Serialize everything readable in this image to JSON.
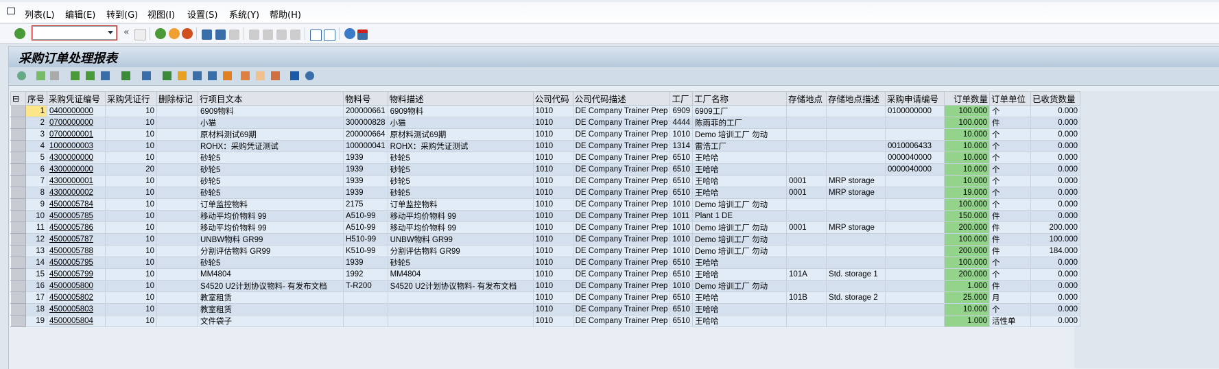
{
  "menu": [
    "列表(L)",
    "编辑(E)",
    "转到(G)",
    "视图(I)",
    "设置(S)",
    "系统(Y)",
    "帮助(H)"
  ],
  "command_field": {
    "value": ""
  },
  "title": "采购订单处理报表",
  "columns": [
    "序号",
    "采购凭证编号",
    "采购凭证行",
    "删除标记",
    "行项目文本",
    "物料号",
    "物料描述",
    "公司代码",
    "公司代码描述",
    "工厂",
    "工厂名称",
    "存储地点",
    "存储地点描述",
    "采购申请编号",
    "订单数量",
    "订单单位",
    "已收货数量"
  ],
  "rows": [
    [
      "1",
      "0400000000",
      "10",
      "",
      "6909物料",
      "200000661",
      "6909物料",
      "1010",
      "DE Company Trainer Prep",
      "6909",
      "6909工厂",
      "",
      "",
      "0100000000",
      "100.000",
      "个",
      "0.000"
    ],
    [
      "2",
      "0700000000",
      "10",
      "",
      "小猫",
      "300000828",
      "小猫",
      "1010",
      "DE Company Trainer Prep",
      "4444",
      "陈雨菲的工厂",
      "",
      "",
      "",
      "100.000",
      "件",
      "0.000"
    ],
    [
      "3",
      "0700000001",
      "10",
      "",
      "原材料测试69期",
      "200000664",
      "原材料测试69期",
      "1010",
      "DE Company Trainer Prep",
      "1010",
      "Demo 培训工厂 勿动",
      "",
      "",
      "",
      "10.000",
      "个",
      "0.000"
    ],
    [
      "4",
      "1000000003",
      "10",
      "",
      "ROHX：采购凭证测试",
      "100000041",
      "ROHX：采购凭证测试",
      "1010",
      "DE Company Trainer Prep",
      "1314",
      "雷浩工厂",
      "",
      "",
      "0010006433",
      "10.000",
      "个",
      "0.000"
    ],
    [
      "5",
      "4300000000",
      "10",
      "",
      "砂轮5",
      "1939",
      "砂轮5",
      "1010",
      "DE Company Trainer Prep",
      "6510",
      "王哈哈",
      "",
      "",
      "0000040000",
      "10.000",
      "个",
      "0.000"
    ],
    [
      "6",
      "4300000000",
      "20",
      "",
      "砂轮5",
      "1939",
      "砂轮5",
      "1010",
      "DE Company Trainer Prep",
      "6510",
      "王哈哈",
      "",
      "",
      "0000040000",
      "10.000",
      "个",
      "0.000"
    ],
    [
      "7",
      "4300000001",
      "10",
      "",
      "砂轮5",
      "1939",
      "砂轮5",
      "1010",
      "DE Company Trainer Prep",
      "6510",
      "王哈哈",
      "0001",
      "MRP storage",
      "",
      "10.000",
      "个",
      "0.000"
    ],
    [
      "8",
      "4300000002",
      "10",
      "",
      "砂轮5",
      "1939",
      "砂轮5",
      "1010",
      "DE Company Trainer Prep",
      "6510",
      "王哈哈",
      "0001",
      "MRP storage",
      "",
      "19.000",
      "个",
      "0.000"
    ],
    [
      "9",
      "4500005784",
      "10",
      "",
      "订单监控物料",
      "2175",
      "订单监控物料",
      "1010",
      "DE Company Trainer Prep",
      "1010",
      "Demo 培训工厂 勿动",
      "",
      "",
      "",
      "100.000",
      "个",
      "0.000"
    ],
    [
      "10",
      "4500005785",
      "10",
      "",
      "移动平均价物料 99",
      "A510-99",
      "移动平均价物料 99",
      "1010",
      "DE Company Trainer Prep",
      "1011",
      "Plant 1 DE",
      "",
      "",
      "",
      "150.000",
      "件",
      "0.000"
    ],
    [
      "11",
      "4500005786",
      "10",
      "",
      "移动平均价物料 99",
      "A510-99",
      "移动平均价物料 99",
      "1010",
      "DE Company Trainer Prep",
      "1010",
      "Demo 培训工厂 勿动",
      "0001",
      "MRP storage",
      "",
      "200.000",
      "件",
      "200.000"
    ],
    [
      "12",
      "4500005787",
      "10",
      "",
      "UNBW物料 GR99",
      "H510-99",
      "UNBW物料 GR99",
      "1010",
      "DE Company Trainer Prep",
      "1010",
      "Demo 培训工厂 勿动",
      "",
      "",
      "",
      "100.000",
      "件",
      "100.000"
    ],
    [
      "13",
      "4500005788",
      "10",
      "",
      "分割评估物料 GR99",
      "K510-99",
      "分割评估物料 GR99",
      "1010",
      "DE Company Trainer Prep",
      "1010",
      "Demo 培训工厂 勿动",
      "",
      "",
      "",
      "200.000",
      "件",
      "184.000"
    ],
    [
      "14",
      "4500005795",
      "10",
      "",
      "砂轮5",
      "1939",
      "砂轮5",
      "1010",
      "DE Company Trainer Prep",
      "6510",
      "王哈哈",
      "",
      "",
      "",
      "100.000",
      "个",
      "0.000"
    ],
    [
      "15",
      "4500005799",
      "10",
      "",
      "MM4804",
      "1992",
      "MM4804",
      "1010",
      "DE Company Trainer Prep",
      "6510",
      "王哈哈",
      "101A",
      "Std. storage 1",
      "",
      "200.000",
      "个",
      "0.000"
    ],
    [
      "16",
      "4500005800",
      "10",
      "",
      "S4520 U2计划协议物料- 有发布文档",
      "T-R200",
      "S4520 U2计划协议物料- 有发布文档",
      "1010",
      "DE Company Trainer Prep",
      "1010",
      "Demo 培训工厂 勿动",
      "",
      "",
      "",
      "1.000",
      "件",
      "0.000"
    ],
    [
      "17",
      "4500005802",
      "10",
      "",
      "教室租赁",
      "",
      "",
      "1010",
      "DE Company Trainer Prep",
      "6510",
      "王哈哈",
      "101B",
      "Std. storage 2",
      "",
      "25.000",
      "月",
      "0.000"
    ],
    [
      "18",
      "4500005803",
      "10",
      "",
      "教室租赁",
      "",
      "",
      "1010",
      "DE Company Trainer Prep",
      "6510",
      "王哈哈",
      "",
      "",
      "",
      "10.000",
      "个",
      "0.000"
    ],
    [
      "19",
      "4500005804",
      "10",
      "",
      "文件袋子",
      "",
      "",
      "1010",
      "DE Company Trainer Prep",
      "6510",
      "王哈哈",
      "",
      "",
      "",
      "1.000",
      "活性单",
      "0.000"
    ]
  ]
}
